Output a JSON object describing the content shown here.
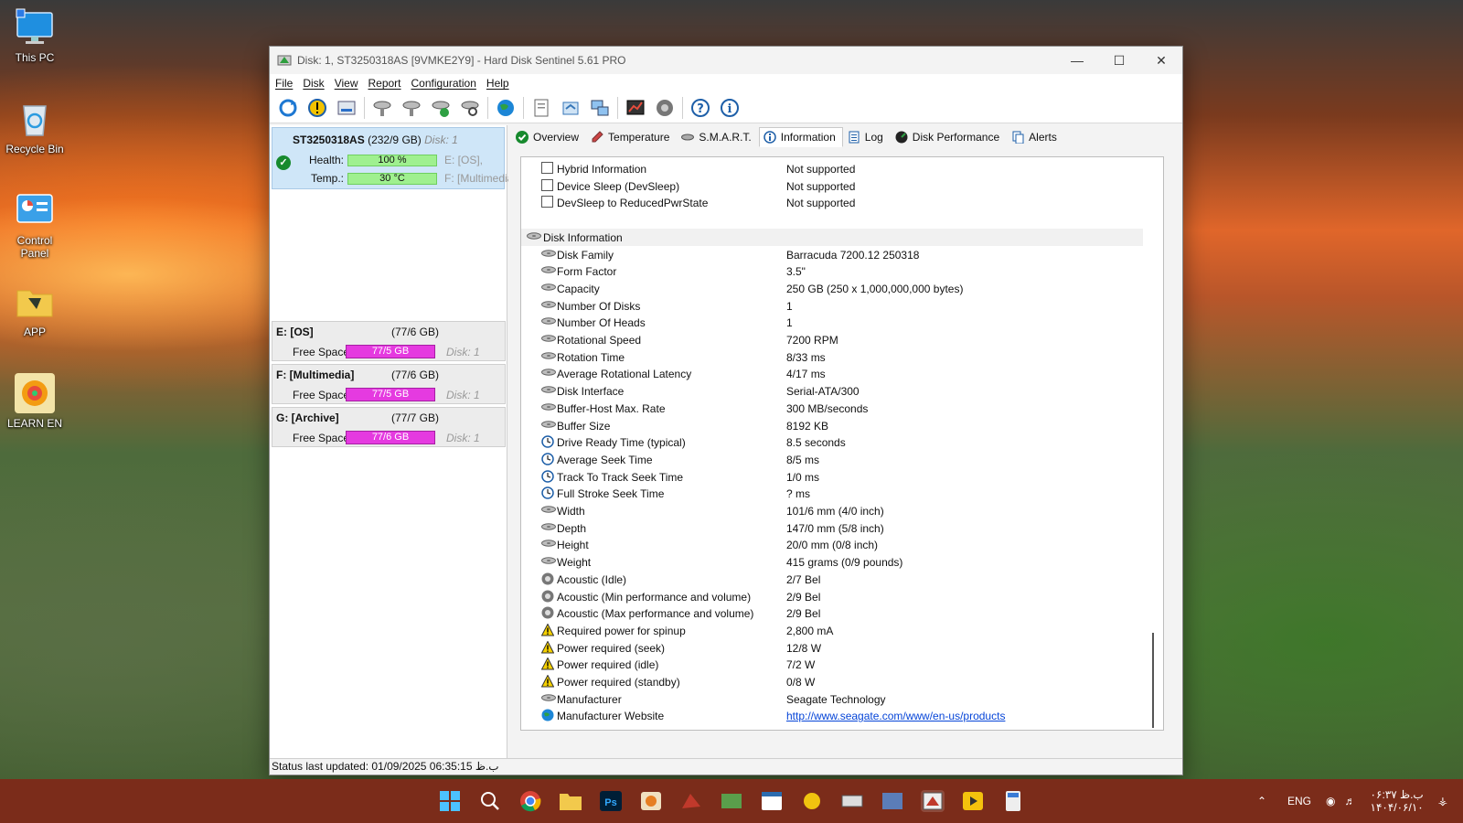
{
  "desktop": {
    "icons": [
      {
        "label": "This PC"
      },
      {
        "label": "Recycle Bin"
      },
      {
        "label": "Control Panel"
      },
      {
        "label": "APP"
      },
      {
        "label": "LEARN EN"
      }
    ]
  },
  "window": {
    "title": "Disk: 1, ST3250318AS [9VMKE2Y9]  -  Hard Disk Sentinel 5.61 PRO",
    "menu": [
      "File",
      "Disk",
      "View",
      "Report",
      "Configuration",
      "Help"
    ]
  },
  "disk": {
    "name": "ST3250318AS",
    "size": "(232/9 GB)",
    "disk_label": "Disk: 1",
    "health_label": "Health:",
    "health_value": "100 %",
    "health_fraction": 1.0,
    "temp_label": "Temp.:",
    "temp_value": "30 °C",
    "vol_line1": "E: [OS],",
    "vol_line2": "F: [Multimedia"
  },
  "volumes": [
    {
      "name": "E: [OS]",
      "size": "(77/6 GB)",
      "free_label": "Free Space",
      "free": "77/5 GB",
      "disk": "Disk: 1"
    },
    {
      "name": "F: [Multimedia]",
      "size": "(77/6 GB)",
      "free_label": "Free Space",
      "free": "77/5 GB",
      "disk": "Disk: 1"
    },
    {
      "name": "G: [Archive]",
      "size": "(77/7 GB)",
      "free_label": "Free Space",
      "free": "77/6 GB",
      "disk": "Disk: 1"
    }
  ],
  "tabs": [
    {
      "label": "Overview",
      "icon": "check-icon"
    },
    {
      "label": "Temperature",
      "icon": "thermometer-icon"
    },
    {
      "label": "S.M.A.R.T.",
      "icon": "disk-icon"
    },
    {
      "label": "Information",
      "icon": "info-icon",
      "active": true
    },
    {
      "label": "Log",
      "icon": "log-icon"
    },
    {
      "label": "Disk Performance",
      "icon": "performance-icon"
    },
    {
      "label": "Alerts",
      "icon": "alerts-icon"
    }
  ],
  "info": {
    "rows": [
      {
        "label": "Hybrid Information",
        "value": "Not supported",
        "icon": "checkbox"
      },
      {
        "label": "Device Sleep (DevSleep)",
        "value": "Not supported",
        "icon": "checkbox"
      },
      {
        "label": "DevSleep to ReducedPwrState",
        "value": "Not supported",
        "icon": "checkbox"
      },
      {
        "label": "",
        "value": "",
        "icon": "blank"
      },
      {
        "label": "Disk Information",
        "value": "",
        "icon": "disk",
        "section": true
      },
      {
        "label": "Disk Family",
        "value": "Barracuda 7200.12 250318",
        "icon": "disk"
      },
      {
        "label": "Form Factor",
        "value": "3.5\"",
        "icon": "disk"
      },
      {
        "label": "Capacity",
        "value": "250 GB (250 x 1,000,000,000 bytes)",
        "icon": "disk"
      },
      {
        "label": "Number Of Disks",
        "value": "1",
        "icon": "disk"
      },
      {
        "label": "Number Of Heads",
        "value": "1",
        "icon": "disk"
      },
      {
        "label": "Rotational Speed",
        "value": "7200 RPM",
        "icon": "disk"
      },
      {
        "label": "Rotation Time",
        "value": "8/33 ms",
        "icon": "disk"
      },
      {
        "label": "Average Rotational Latency",
        "value": "4/17 ms",
        "icon": "disk"
      },
      {
        "label": "Disk Interface",
        "value": "Serial-ATA/300",
        "icon": "disk"
      },
      {
        "label": "Buffer-Host Max. Rate",
        "value": "300 MB/seconds",
        "icon": "disk"
      },
      {
        "label": "Buffer Size",
        "value": "8192 KB",
        "icon": "disk"
      },
      {
        "label": "Drive Ready Time (typical)",
        "value": "8.5 seconds",
        "icon": "clock"
      },
      {
        "label": "Average Seek Time",
        "value": "8/5 ms",
        "icon": "clock"
      },
      {
        "label": "Track To Track Seek Time",
        "value": "1/0 ms",
        "icon": "clock"
      },
      {
        "label": "Full Stroke Seek Time",
        "value": "? ms",
        "icon": "clock"
      },
      {
        "label": "Width",
        "value": "101/6 mm (4/0 inch)",
        "icon": "disk"
      },
      {
        "label": "Depth",
        "value": "147/0 mm (5/8 inch)",
        "icon": "disk"
      },
      {
        "label": "Height",
        "value": "20/0 mm (0/8 inch)",
        "icon": "disk"
      },
      {
        "label": "Weight",
        "value": "415 grams (0/9 pounds)",
        "icon": "disk"
      },
      {
        "label": "Acoustic (Idle)",
        "value": "2/7 Bel",
        "icon": "speaker"
      },
      {
        "label": "Acoustic (Min performance and volume)",
        "value": "2/9 Bel",
        "icon": "speaker"
      },
      {
        "label": "Acoustic (Max performance and volume)",
        "value": "2/9 Bel",
        "icon": "speaker"
      },
      {
        "label": "Required power for spinup",
        "value": "2,800 mA",
        "icon": "warning"
      },
      {
        "label": "Power required (seek)",
        "value": "12/8 W",
        "icon": "warning"
      },
      {
        "label": "Power required (idle)",
        "value": "7/2 W",
        "icon": "warning"
      },
      {
        "label": "Power required (standby)",
        "value": "0/8 W",
        "icon": "warning"
      },
      {
        "label": "Manufacturer",
        "value": "Seagate Technology",
        "icon": "disk"
      },
      {
        "label": "Manufacturer Website",
        "value": "http://www.seagate.com/www/en-us/products",
        "icon": "globe",
        "link": true
      }
    ]
  },
  "status": "Status last updated: 01/09/2025 06:35:15 ب.ظ",
  "tray": {
    "lang": "ENG",
    "time": "۰۶:۳۷ ب.ظ",
    "date": "۱۴۰۴/۰۶/۱۰"
  },
  "colors": {
    "health_bar": "#9ff08f",
    "free_space_bar": "#e53ae0",
    "selected_disk": "#cfe6f8",
    "taskbar": "#7b2c1a",
    "link": "#0645d8"
  }
}
